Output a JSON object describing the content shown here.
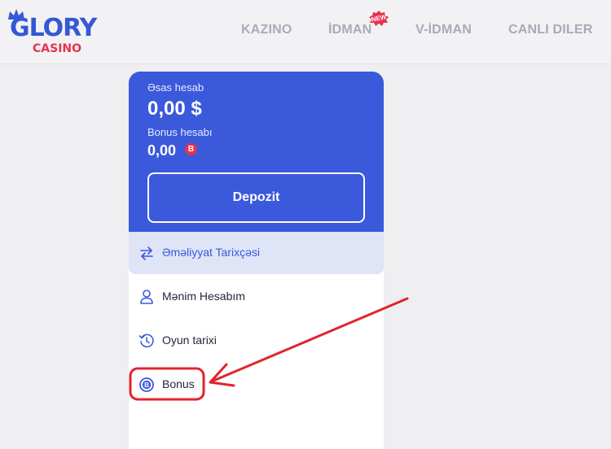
{
  "header": {
    "logo_top": "GLORY",
    "logo_bottom": "CASINO",
    "nav": [
      "KAZINO",
      "İDMAN",
      "V-İDMAN",
      "CANLI DILER"
    ],
    "new_badge": "NEW"
  },
  "balance": {
    "main_label": "Əsas hesab",
    "main_amount": "0,00 $",
    "bonus_label": "Bonus hesabı",
    "bonus_amount": "0,00",
    "bonus_currency": "B",
    "deposit_label": "Depozit"
  },
  "menu": [
    {
      "label": "Əməliyyat Tarixçəsi",
      "icon": "transfer-arrows-icon",
      "active": true
    },
    {
      "label": "Mənim Hesabım",
      "icon": "user-icon"
    },
    {
      "label": "Oyun tarixi",
      "icon": "history-icon"
    },
    {
      "label": "Bonus",
      "icon": "bonus-coin-icon"
    }
  ],
  "colors": {
    "brand_blue": "#3b59db",
    "brand_red": "#e6334f",
    "annotation_red": "#e0242c"
  }
}
